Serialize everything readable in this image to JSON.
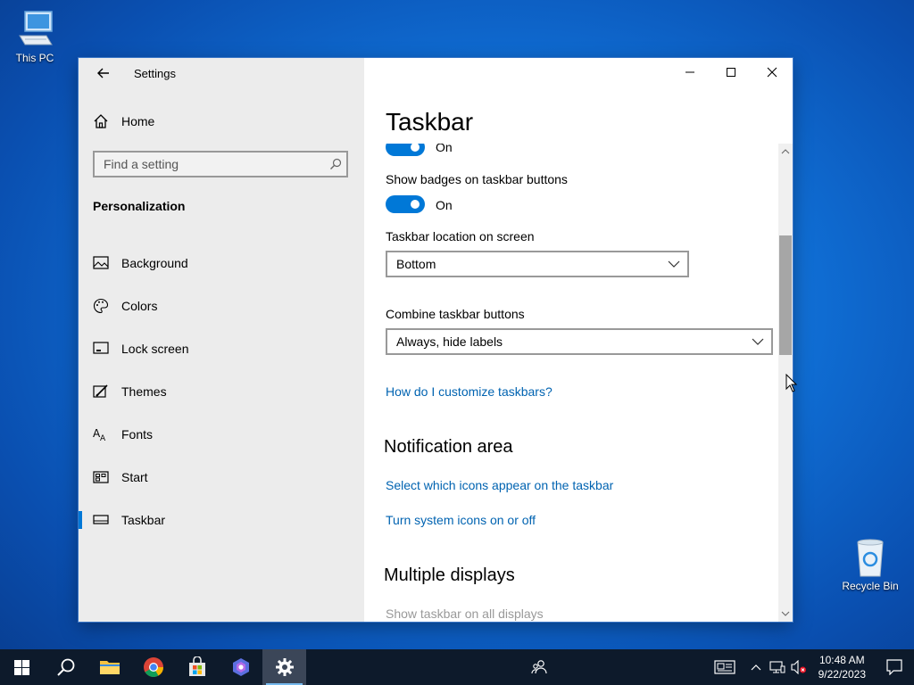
{
  "desktop": {
    "this_pc_label": "This PC",
    "recycle_bin_label": "Recycle Bin"
  },
  "window": {
    "title": "Settings",
    "sidebar": {
      "home_label": "Home",
      "search_placeholder": "Find a setting",
      "section_title": "Personalization",
      "items": [
        {
          "label": "Background",
          "icon": "image-icon"
        },
        {
          "label": "Colors",
          "icon": "palette-icon"
        },
        {
          "label": "Lock screen",
          "icon": "lock-screen-icon"
        },
        {
          "label": "Themes",
          "icon": "themes-icon"
        },
        {
          "label": "Fonts",
          "icon": "fonts-icon"
        },
        {
          "label": "Start",
          "icon": "start-icon"
        },
        {
          "label": "Taskbar",
          "icon": "taskbar-icon",
          "active": true
        }
      ]
    },
    "content": {
      "page_title": "Taskbar",
      "toggle_top_state": "On",
      "badges_label": "Show badges on taskbar buttons",
      "badges_state": "On",
      "location_label": "Taskbar location on screen",
      "location_value": "Bottom",
      "combine_label": "Combine taskbar buttons",
      "combine_value": "Always, hide labels",
      "help_link": "How do I customize taskbars?",
      "notification_heading": "Notification area",
      "notif_link_1": "Select which icons appear on the taskbar",
      "notif_link_2": "Turn system icons on or off",
      "multi_heading": "Multiple displays",
      "multi_label": "Show taskbar on all displays"
    }
  },
  "taskbar": {
    "time": "10:48 AM",
    "date": "9/22/2023",
    "accent": "#0078d7"
  }
}
